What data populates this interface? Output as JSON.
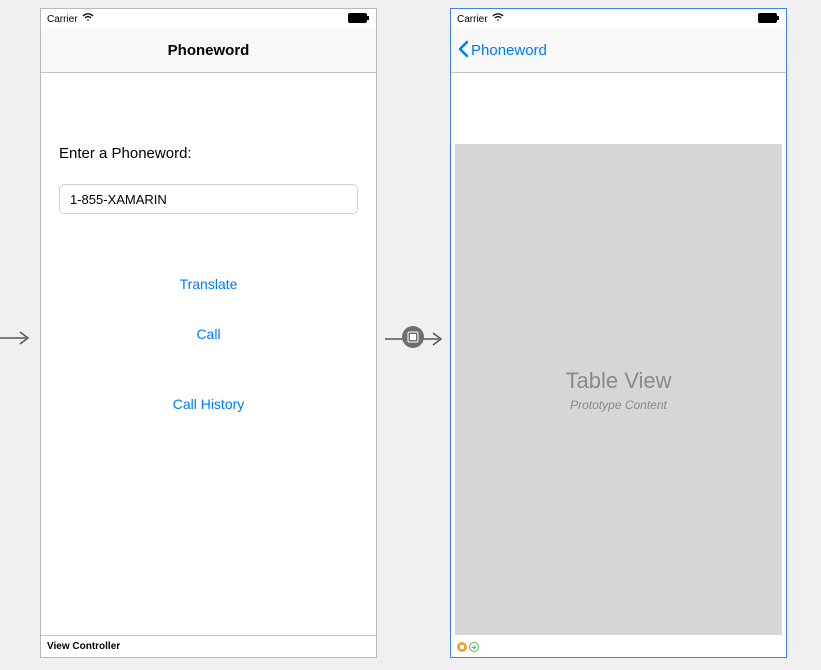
{
  "status": {
    "carrier": "Carrier"
  },
  "screen1": {
    "nav_title": "Phoneword",
    "enter_label": "Enter a Phoneword:",
    "text_value": "1-855-XAMARIN",
    "translate_button": "Translate",
    "call_button": "Call",
    "history_button": "Call History",
    "controller_label": "View Controller"
  },
  "screen2": {
    "back_label": "Phoneword",
    "table_title": "Table View",
    "table_subtitle": "Prototype Content"
  }
}
